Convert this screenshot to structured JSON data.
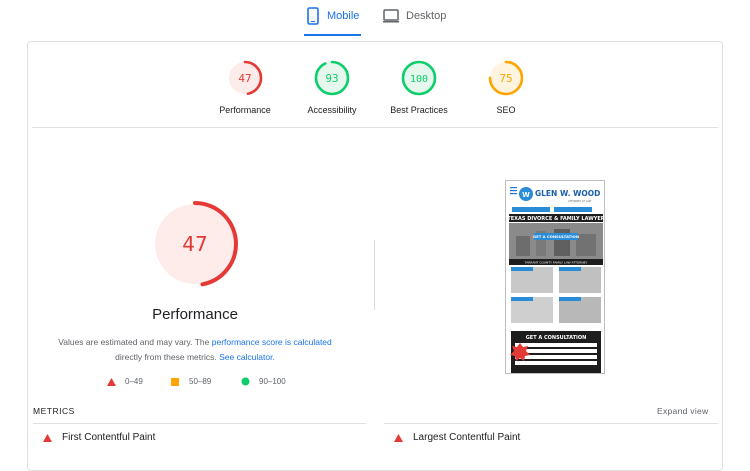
{
  "tabs": [
    {
      "label": "Mobile",
      "active": true
    },
    {
      "label": "Desktop",
      "active": false
    }
  ],
  "summary": [
    {
      "score": "47",
      "label": "Performance",
      "value": 47,
      "color": "#e53935",
      "bg": "#fdecea"
    },
    {
      "score": "93",
      "label": "Accessibility",
      "value": 93,
      "color": "#0cce6b",
      "bg": "#e6f7ee"
    },
    {
      "score": "100",
      "label": "Best Practices",
      "value": 100,
      "color": "#0cce6b",
      "bg": "#e6f7ee"
    },
    {
      "score": "75",
      "label": "SEO",
      "value": 75,
      "color": "#ffa400",
      "bg": "#fff4e0"
    }
  ],
  "performance": {
    "score": "47",
    "value": 47,
    "title": "Performance",
    "note_1": "Values are estimated and may vary. The ",
    "note_link_1": "performance score is calculated",
    "note_2": " directly from these metrics. ",
    "note_link_2": "See calculator."
  },
  "legend": [
    {
      "range": "0–49",
      "shape": "triangle",
      "color": "#e53935"
    },
    {
      "range": "50–89",
      "shape": "square",
      "color": "#ffa400"
    },
    {
      "range": "90–100",
      "shape": "circle",
      "color": "#0cce6b"
    }
  ],
  "screenshot": {
    "brand": "GLEN W. WOOD",
    "brand_sub": "ATTORNEY AT LAW",
    "headline": "TEXAS DIVORCE & FAMILY LAWYER",
    "cta": "GET A CONSULTATION",
    "sub_heading": "TARRANT COUNTY FAMILY LAW ATTORNEY",
    "form_title": "GET A CONSULTATION"
  },
  "metrics": {
    "header": "METRICS",
    "expand": "Expand view",
    "items": [
      {
        "label": "First Contentful Paint"
      },
      {
        "label": "Largest Contentful Paint"
      }
    ]
  }
}
